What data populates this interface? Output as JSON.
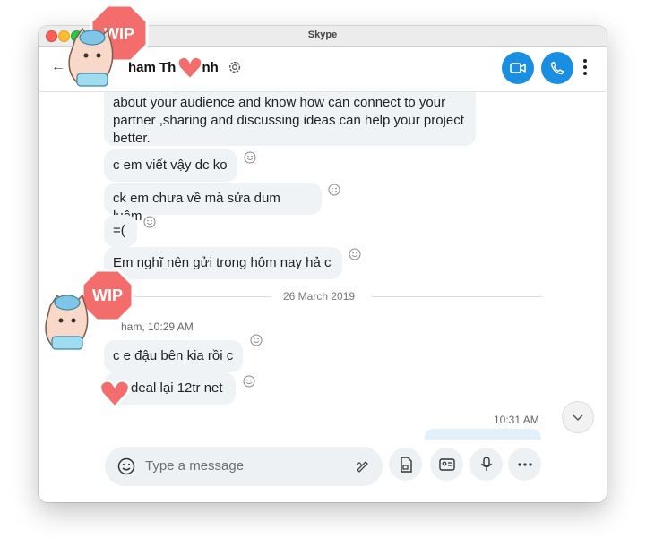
{
  "window": {
    "title": "Skype"
  },
  "header": {
    "contact_name": "ham Th       nh",
    "back_label": "←"
  },
  "messages": [
    {
      "text_lines": [
        "about your audience and know how can connect to your",
        "partner ,sharing and discussing ideas can help your project",
        "better."
      ]
    },
    {
      "text": "c em viết vậy dc ko"
    },
    {
      "text": "ck em chưa về mà sửa dum luôm"
    },
    {
      "text": "=("
    },
    {
      "text": "Em nghĩ nên gửi trong hôm nay hả c"
    },
    {
      "text": "c e đậu bên kia rồi c"
    },
    {
      "text": "deal lại 12tr net"
    }
  ],
  "divider_date": "26 March 2019",
  "sender_meta": "ham, 10:29 AM",
  "outgoing_time": "10:31 AM",
  "composer": {
    "placeholder": "Type a message"
  },
  "stickers": {
    "wip_text": "WIP"
  },
  "colors": {
    "accent": "#1a8ee1",
    "bubble": "#f0f3f6",
    "wip": "#f36d6d"
  }
}
